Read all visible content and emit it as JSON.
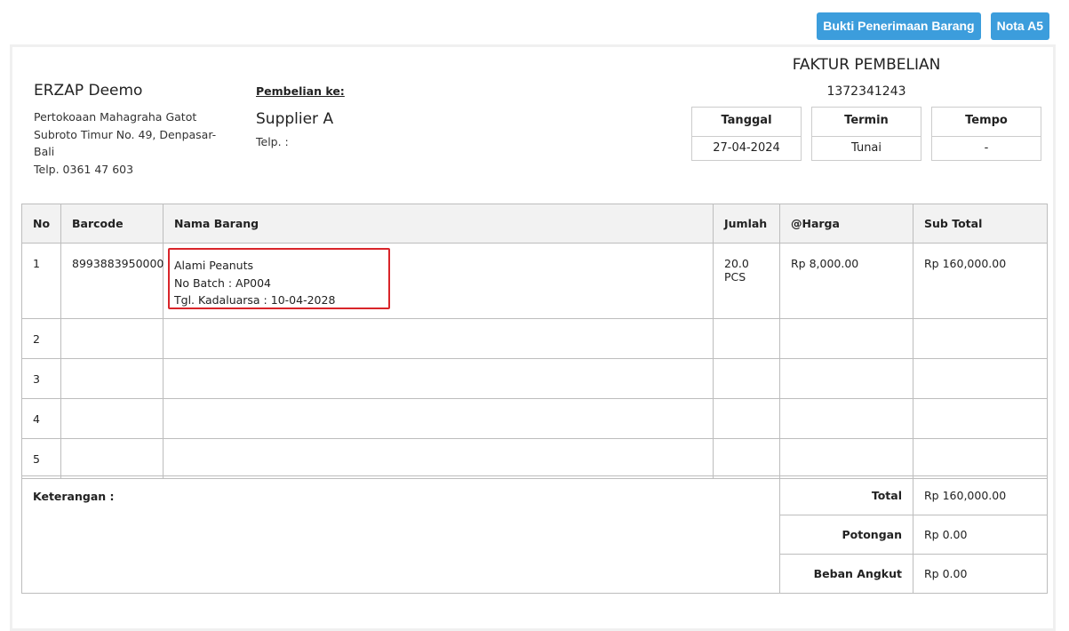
{
  "toolbar": {
    "bukti_label": "Bukti Penerimaan Barang",
    "nota_label": "Nota A5"
  },
  "company": {
    "name": "ERZAP Deemo",
    "address_line1": "Pertokoaan Mahagraha Gatot",
    "address_line2": "Subroto Timur No. 49, Denpasar-",
    "address_line3": "Bali",
    "phone": "Telp. 0361 47 603"
  },
  "supplier": {
    "label": "Pembelian ke:",
    "name": "Supplier A",
    "phone": "Telp. :"
  },
  "invoice": {
    "title": "FAKTUR PEMBELIAN",
    "number": "1372341243"
  },
  "meta": {
    "tanggal_label": "Tanggal",
    "tanggal_value": "27-04-2024",
    "termin_label": "Termin",
    "termin_value": "Tunai",
    "tempo_label": "Tempo",
    "tempo_value": "-"
  },
  "table": {
    "headers": [
      "No",
      "Barcode",
      "Nama Barang",
      "Jumlah",
      "@Harga",
      "Sub Total"
    ],
    "rows": [
      {
        "no": "1",
        "barcode": "8993883950000",
        "name": "Alami Peanuts",
        "batch": "No Batch : AP004",
        "expiry": "Tgl. Kadaluarsa : 10-04-2028",
        "qty": "20.0 PCS",
        "price": "Rp 8,000.00",
        "subtotal": "Rp 160,000.00"
      },
      {
        "no": "2"
      },
      {
        "no": "3"
      },
      {
        "no": "4"
      },
      {
        "no": "5"
      }
    ]
  },
  "summary": {
    "keterangan_label": "Keterangan :",
    "total_label": "Total",
    "total_value": "Rp 160,000.00",
    "potongan_label": "Potongan",
    "potongan_value": "Rp 0.00",
    "beban_label": "Beban Angkut",
    "beban_value": "Rp 0.00"
  },
  "colors": {
    "button": "#3c9ddc",
    "highlight": "#d9252a",
    "header_bg": "#f2f2f2"
  }
}
